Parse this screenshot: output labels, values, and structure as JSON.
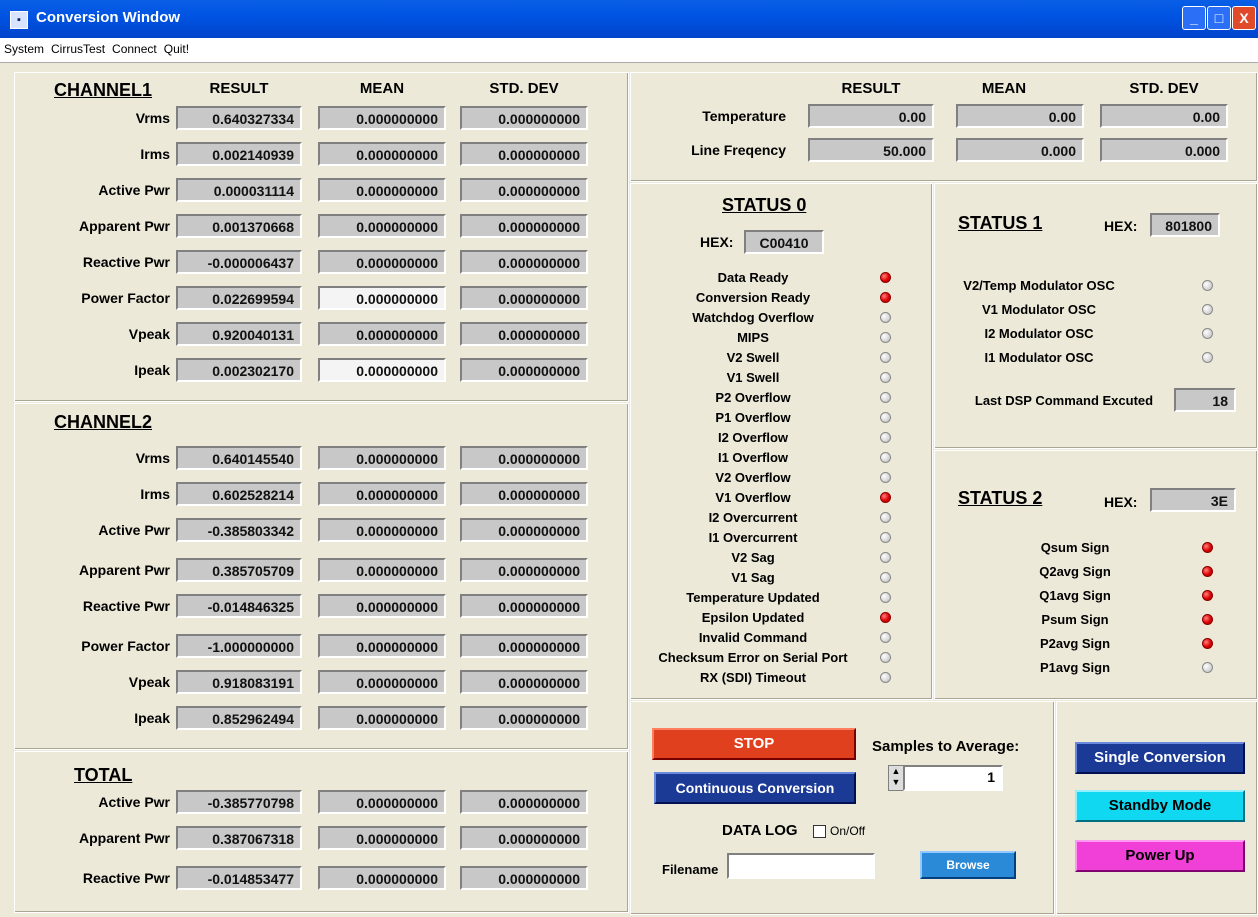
{
  "window": {
    "title": "Conversion Window",
    "min": "_",
    "max": "□",
    "close": "X"
  },
  "menu": [
    "System",
    "CirrusTest",
    "Connect",
    "Quit!"
  ],
  "headers": {
    "result": "RESULT",
    "mean": "MEAN",
    "std": "STD. DEV"
  },
  "channel1": {
    "title": "CHANNEL1",
    "rows": [
      {
        "label": "Vrms",
        "result": "0.640327334",
        "mean": "0.000000000",
        "std": "0.000000000"
      },
      {
        "label": "Irms",
        "result": "0.002140939",
        "mean": "0.000000000",
        "std": "0.000000000"
      },
      {
        "label": "Active Pwr",
        "result": "0.000031114",
        "mean": "0.000000000",
        "std": "0.000000000"
      },
      {
        "label": "Apparent Pwr",
        "result": "0.001370668",
        "mean": "0.000000000",
        "std": "0.000000000"
      },
      {
        "label": "Reactive Pwr",
        "result": "-0.000006437",
        "mean": "0.000000000",
        "std": "0.000000000"
      },
      {
        "label": "Power Factor",
        "result": "0.022699594",
        "mean": "0.000000000",
        "std": "0.000000000"
      },
      {
        "label": "Vpeak",
        "result": "0.920040131",
        "mean": "0.000000000",
        "std": "0.000000000"
      },
      {
        "label": "Ipeak",
        "result": "0.002302170",
        "mean": "0.000000000",
        "std": "0.000000000"
      }
    ]
  },
  "channel2": {
    "title": "CHANNEL2",
    "rows": [
      {
        "label": "Vrms",
        "result": "0.640145540",
        "mean": "0.000000000",
        "std": "0.000000000"
      },
      {
        "label": "Irms",
        "result": "0.602528214",
        "mean": "0.000000000",
        "std": "0.000000000"
      },
      {
        "label": "Active Pwr",
        "result": "-0.385803342",
        "mean": "0.000000000",
        "std": "0.000000000"
      },
      {
        "label": "Apparent Pwr",
        "result": "0.385705709",
        "mean": "0.000000000",
        "std": "0.000000000"
      },
      {
        "label": "Reactive Pwr",
        "result": "-0.014846325",
        "mean": "0.000000000",
        "std": "0.000000000"
      },
      {
        "label": "Power Factor",
        "result": "-1.000000000",
        "mean": "0.000000000",
        "std": "0.000000000"
      },
      {
        "label": "Vpeak",
        "result": "0.918083191",
        "mean": "0.000000000",
        "std": "0.000000000"
      },
      {
        "label": "Ipeak",
        "result": "0.852962494",
        "mean": "0.000000000",
        "std": "0.000000000"
      }
    ]
  },
  "total": {
    "title": "TOTAL",
    "rows": [
      {
        "label": "Active Pwr",
        "result": "-0.385770798",
        "mean": "0.000000000",
        "std": "0.000000000"
      },
      {
        "label": "Apparent Pwr",
        "result": "0.387067318",
        "mean": "0.000000000",
        "std": "0.000000000"
      },
      {
        "label": "Reactive Pwr",
        "result": "-0.014853477",
        "mean": "0.000000000",
        "std": "0.000000000"
      }
    ]
  },
  "misc": {
    "rows": [
      {
        "label": "Temperature",
        "result": "0.00",
        "mean": "0.00",
        "std": "0.00"
      },
      {
        "label": "Line Freqency",
        "result": "50.000",
        "mean": "0.000",
        "std": "0.000"
      }
    ]
  },
  "status0": {
    "title": "STATUS 0",
    "hex_label": "HEX:",
    "hex": "C00410",
    "items": [
      {
        "label": "Data Ready",
        "on": true
      },
      {
        "label": "Conversion Ready",
        "on": true
      },
      {
        "label": "Watchdog Overflow",
        "on": false
      },
      {
        "label": "MIPS",
        "on": false
      },
      {
        "label": "V2 Swell",
        "on": false
      },
      {
        "label": "V1 Swell",
        "on": false
      },
      {
        "label": "P2 Overflow",
        "on": false
      },
      {
        "label": "P1 Overflow",
        "on": false
      },
      {
        "label": "I2 Overflow",
        "on": false
      },
      {
        "label": "I1 Overflow",
        "on": false
      },
      {
        "label": "V2 Overflow",
        "on": false
      },
      {
        "label": "V1 Overflow",
        "on": true
      },
      {
        "label": "I2 Overcurrent",
        "on": false
      },
      {
        "label": "I1 Overcurrent",
        "on": false
      },
      {
        "label": "V2 Sag",
        "on": false
      },
      {
        "label": "V1 Sag",
        "on": false
      },
      {
        "label": "Temperature Updated",
        "on": false
      },
      {
        "label": "Epsilon Updated",
        "on": true
      },
      {
        "label": "Invalid Command",
        "on": false
      },
      {
        "label": "Checksum Error on Serial Port",
        "on": false
      },
      {
        "label": "RX (SDI) Timeout",
        "on": false
      }
    ]
  },
  "status1": {
    "title": "STATUS 1",
    "hex_label": "HEX:",
    "hex": "801800",
    "items": [
      {
        "label": "V2/Temp Modulator OSC",
        "on": false
      },
      {
        "label": "V1 Modulator OSC",
        "on": false
      },
      {
        "label": "I2 Modulator OSC",
        "on": false
      },
      {
        "label": "I1 Modulator OSC",
        "on": false
      }
    ],
    "last_cmd_label": "Last DSP Command Excuted",
    "last_cmd": "18"
  },
  "status2": {
    "title": "STATUS 2",
    "hex_label": "HEX:",
    "hex": "3E",
    "items": [
      {
        "label": "Qsum Sign",
        "on": true
      },
      {
        "label": "Q2avg Sign",
        "on": true
      },
      {
        "label": "Q1avg Sign",
        "on": true
      },
      {
        "label": "Psum Sign",
        "on": true
      },
      {
        "label": "P2avg Sign",
        "on": true
      },
      {
        "label": "P1avg Sign",
        "on": false
      }
    ]
  },
  "controls": {
    "stop": "STOP",
    "continuous": "Continuous Conversion",
    "samples_label": "Samples to Average:",
    "samples": "1",
    "datalog": "DATA LOG",
    "onoff": "On/Off",
    "filename_label": "Filename",
    "filename": "",
    "browse": "Browse",
    "single": "Single Conversion",
    "standby": "Standby Mode",
    "powerup": "Power Up"
  },
  "colors": {
    "led_on": "#e00000",
    "led_off": "#bbbbbb",
    "stop": "#e0401e",
    "blue_btn": "#1a3a96",
    "cyan_btn": "#10d8f0",
    "pink_btn": "#f040d8"
  }
}
